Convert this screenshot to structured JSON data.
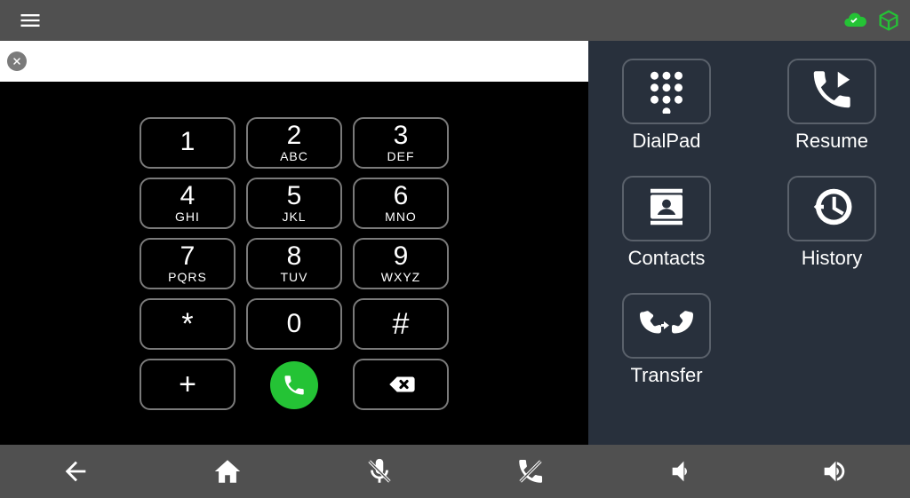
{
  "topbar": {},
  "dial": {
    "field_value": "",
    "keys": [
      {
        "digit": "1",
        "letters": ""
      },
      {
        "digit": "2",
        "letters": "ABC"
      },
      {
        "digit": "3",
        "letters": "DEF"
      },
      {
        "digit": "4",
        "letters": "GHI"
      },
      {
        "digit": "5",
        "letters": "JKL"
      },
      {
        "digit": "6",
        "letters": "MNO"
      },
      {
        "digit": "7",
        "letters": "PQRS"
      },
      {
        "digit": "8",
        "letters": "TUV"
      },
      {
        "digit": "9",
        "letters": "WXYZ"
      },
      {
        "digit": "*",
        "letters": ""
      },
      {
        "digit": "0",
        "letters": ""
      },
      {
        "digit": "#",
        "letters": ""
      },
      {
        "digit": "+",
        "letters": ""
      }
    ]
  },
  "tiles": {
    "dialpad": {
      "label": "DialPad"
    },
    "resume": {
      "label": "Resume"
    },
    "contacts": {
      "label": "Contacts"
    },
    "history": {
      "label": "History"
    },
    "transfer": {
      "label": "Transfer"
    }
  },
  "colors": {
    "accent_green": "#24c335",
    "status_green": "#24c335",
    "panel_right": "#28303c",
    "bar": "#505050"
  }
}
